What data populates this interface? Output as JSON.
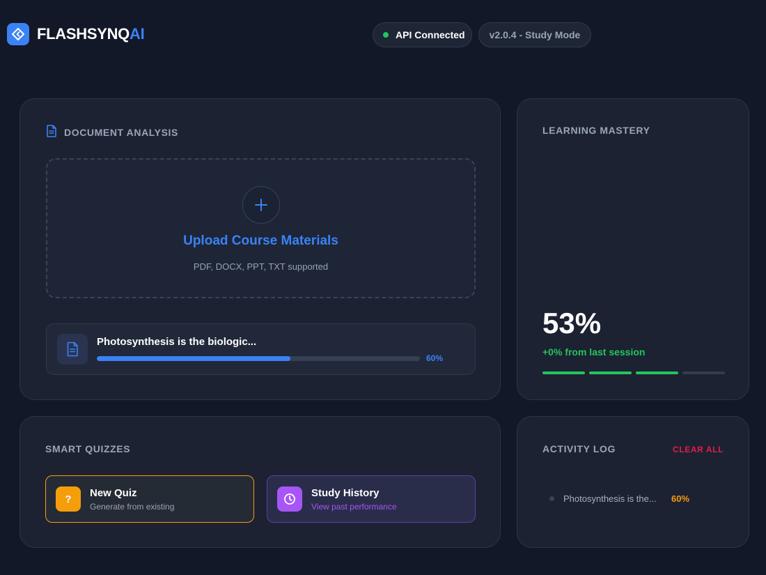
{
  "header": {
    "brand_main": "FLASHSYNQ",
    "brand_accent": "AI",
    "logo_icon": "diamond-code-icon",
    "api_status": "API Connected",
    "api_status_color": "#22c55e",
    "version": "v2.0.4 - Study Mode"
  },
  "document_analysis": {
    "title": "DOCUMENT ANALYSIS",
    "icon": "document-icon",
    "upload": {
      "icon": "plus-icon",
      "title": "Upload Course Materials",
      "subtitle": "PDF, DOCX, PPT, TXT supported"
    },
    "file": {
      "icon": "document-icon",
      "name": "Photosynthesis is the biologic...",
      "progress": 60,
      "progress_label": "60%"
    }
  },
  "learning_mastery": {
    "title": "LEARNING MASTERY",
    "value": "53%",
    "delta": "+0% from last session",
    "segments_filled": 3,
    "segments_total": 4
  },
  "smart_quizzes": {
    "title": "SMART QUIZZES",
    "actions": [
      {
        "label": "New Quiz",
        "sublabel": "Generate from existing",
        "icon": "question-icon",
        "accent": "#f59e0b"
      },
      {
        "label": "Study History",
        "sublabel": "View past performance",
        "icon": "clock-icon",
        "accent": "#a855f7"
      }
    ]
  },
  "activity_log": {
    "title": "ACTIVITY LOG",
    "clear_label": "CLEAR ALL",
    "items": [
      {
        "text": "Photosynthesis is the...",
        "value": "60%"
      }
    ]
  },
  "colors": {
    "accent": "#3b82f6",
    "success": "#22c55e",
    "warning": "#f59e0b",
    "purple": "#a855f7",
    "danger": "#e11d48"
  }
}
